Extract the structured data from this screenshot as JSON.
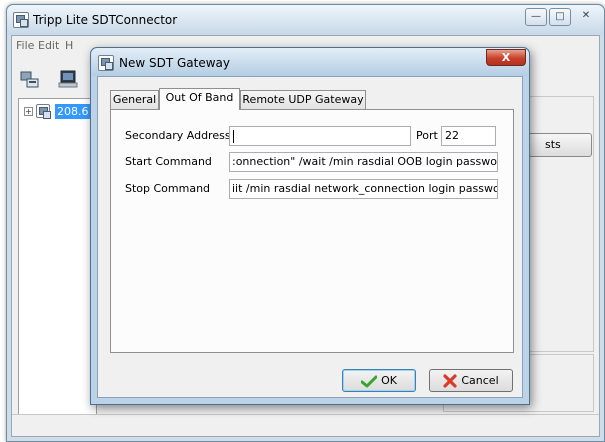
{
  "main_window": {
    "title": "Tripp Lite SDTConnector",
    "controls": {
      "minimize": "—",
      "maximize": "□",
      "close": "✕"
    },
    "menu": [
      "File",
      "Edit",
      "H"
    ],
    "tree": {
      "expander": "⊞",
      "node_label": "208.6"
    },
    "right_button_label": "sts"
  },
  "dialog": {
    "title": "New SDT Gateway",
    "close_label": "X",
    "tabs": [
      {
        "label": "General",
        "active": false
      },
      {
        "label": "Out Of Band",
        "active": true
      },
      {
        "label": "Remote UDP Gateway",
        "active": false
      }
    ],
    "fields": {
      "secondary_address": {
        "label": "Secondary Address",
        "value": ""
      },
      "port": {
        "label": "Port",
        "value": "22"
      },
      "start_command": {
        "label": "Start Command",
        "value": ":onnection\" /wait /min rasdial OOB login password"
      },
      "stop_command": {
        "label": "Stop Command",
        "value": "iit /min rasdial network_connection login password"
      }
    },
    "buttons": {
      "ok": "OK",
      "cancel": "Cancel"
    }
  },
  "colors": {
    "accent": "#3399ff",
    "close_red": "#c7402a",
    "ok_check": "#3aa335",
    "cancel_x": "#d93b2b"
  },
  "icons": [
    "app-icon",
    "gateway-icon",
    "computer-icon",
    "check-icon",
    "cancel-x-icon"
  ]
}
